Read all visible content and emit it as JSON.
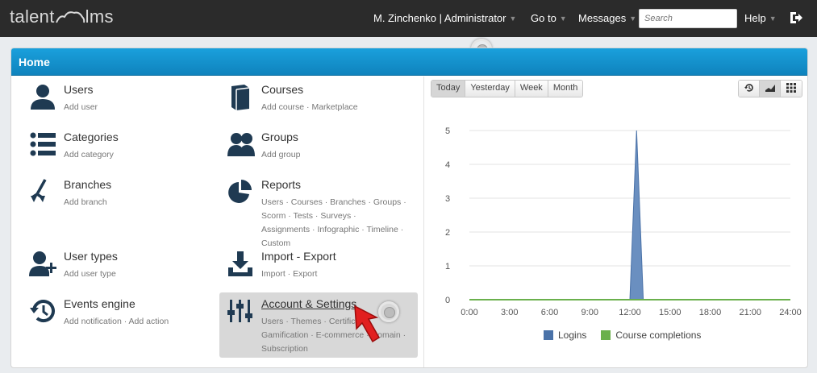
{
  "topbar": {
    "logo_left": "talent",
    "logo_right": "lms",
    "user_label": "M. Zinchenko | Administrator",
    "goto_label": "Go to",
    "messages_label": "Messages",
    "search_placeholder": "Search",
    "help_label": "Help",
    "logout_icon": "logout-icon"
  },
  "panel": {
    "title": "Home"
  },
  "items": [
    {
      "title": "Users",
      "sub": "Add user",
      "icon": "user-icon"
    },
    {
      "title": "Categories",
      "sub": "Add category",
      "icon": "list-icon"
    },
    {
      "title": "Branches",
      "sub": "Add branch",
      "icon": "branch-icon"
    },
    {
      "title": "User types",
      "sub": "Add user type",
      "icon": "user-add-icon"
    },
    {
      "title": "Events engine",
      "sub": "Add notification · Add action",
      "icon": "history-icon"
    },
    {
      "title": "Courses",
      "sub": "Add course · Marketplace",
      "icon": "book-icon"
    },
    {
      "title": "Groups",
      "sub": "Add group",
      "icon": "group-icon"
    },
    {
      "title": "Reports",
      "sub": "Users · Courses · Branches · Groups · Scorm · Tests · Surveys · Assignments · Infographic · Timeline · Custom",
      "icon": "pie-chart-icon"
    },
    {
      "title": "Import - Export",
      "sub": "Import · Export",
      "icon": "download-icon"
    },
    {
      "title": "Account & Settings",
      "sub": "Users · Themes · Certificat... Gamification · E-commerce · Domain · Subscription",
      "icon": "sliders-icon"
    }
  ],
  "range_tabs": [
    "Today",
    "Yesterday",
    "Week",
    "Month"
  ],
  "range_active": "Today",
  "view_icons": [
    "history-icon",
    "area-chart-icon",
    "grid-icon"
  ],
  "chart_data": {
    "type": "area",
    "x": [
      "0:00",
      "3:00",
      "6:00",
      "9:00",
      "12:00",
      "15:00",
      "18:00",
      "21:00",
      "24:00"
    ],
    "ylim": [
      0,
      5
    ],
    "yticks": [
      0,
      1,
      2,
      3,
      4,
      5
    ],
    "series": [
      {
        "name": "Logins",
        "color": "#4a72a8",
        "points": [
          [
            0,
            0
          ],
          [
            12,
            0
          ],
          [
            12.5,
            5
          ],
          [
            13,
            0
          ],
          [
            24,
            0
          ]
        ]
      },
      {
        "name": "Course completions",
        "color": "#6ab04c",
        "points": [
          [
            0,
            0
          ],
          [
            24,
            0
          ]
        ]
      }
    ]
  }
}
